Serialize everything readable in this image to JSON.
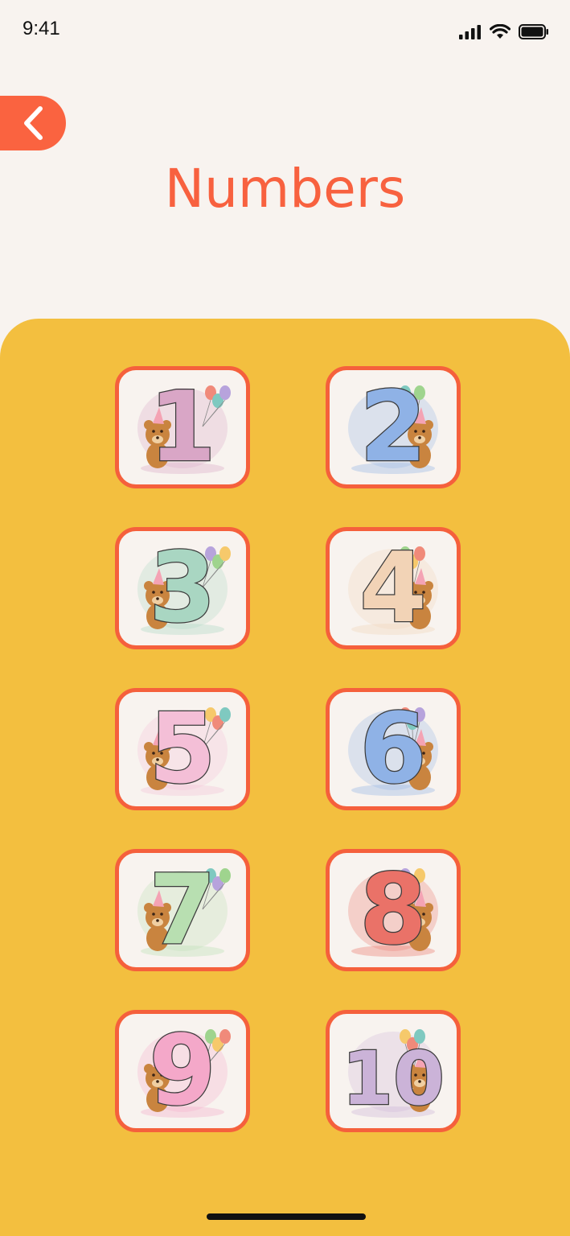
{
  "status_bar": {
    "time": "9:41"
  },
  "header": {
    "title": "Numbers"
  },
  "numbers": [
    {
      "label": "1",
      "color": "#d9a6c6"
    },
    {
      "label": "2",
      "color": "#8fb2e6"
    },
    {
      "label": "3",
      "color": "#a9d6c2"
    },
    {
      "label": "4",
      "color": "#f2d3b6"
    },
    {
      "label": "5",
      "color": "#f4bfd7"
    },
    {
      "label": "6",
      "color": "#8fb2e6"
    },
    {
      "label": "7",
      "color": "#b8dfb1"
    },
    {
      "label": "8",
      "color": "#ea7268"
    },
    {
      "label": "9",
      "color": "#f4a8c9"
    },
    {
      "label": "10",
      "color": "#cbb3d8"
    }
  ],
  "colors": {
    "background": "#f8f3ef",
    "accent": "#f8613f",
    "panel": "#f3bf3f",
    "tile_border": "#f5603c",
    "bear": "#c9843f"
  }
}
